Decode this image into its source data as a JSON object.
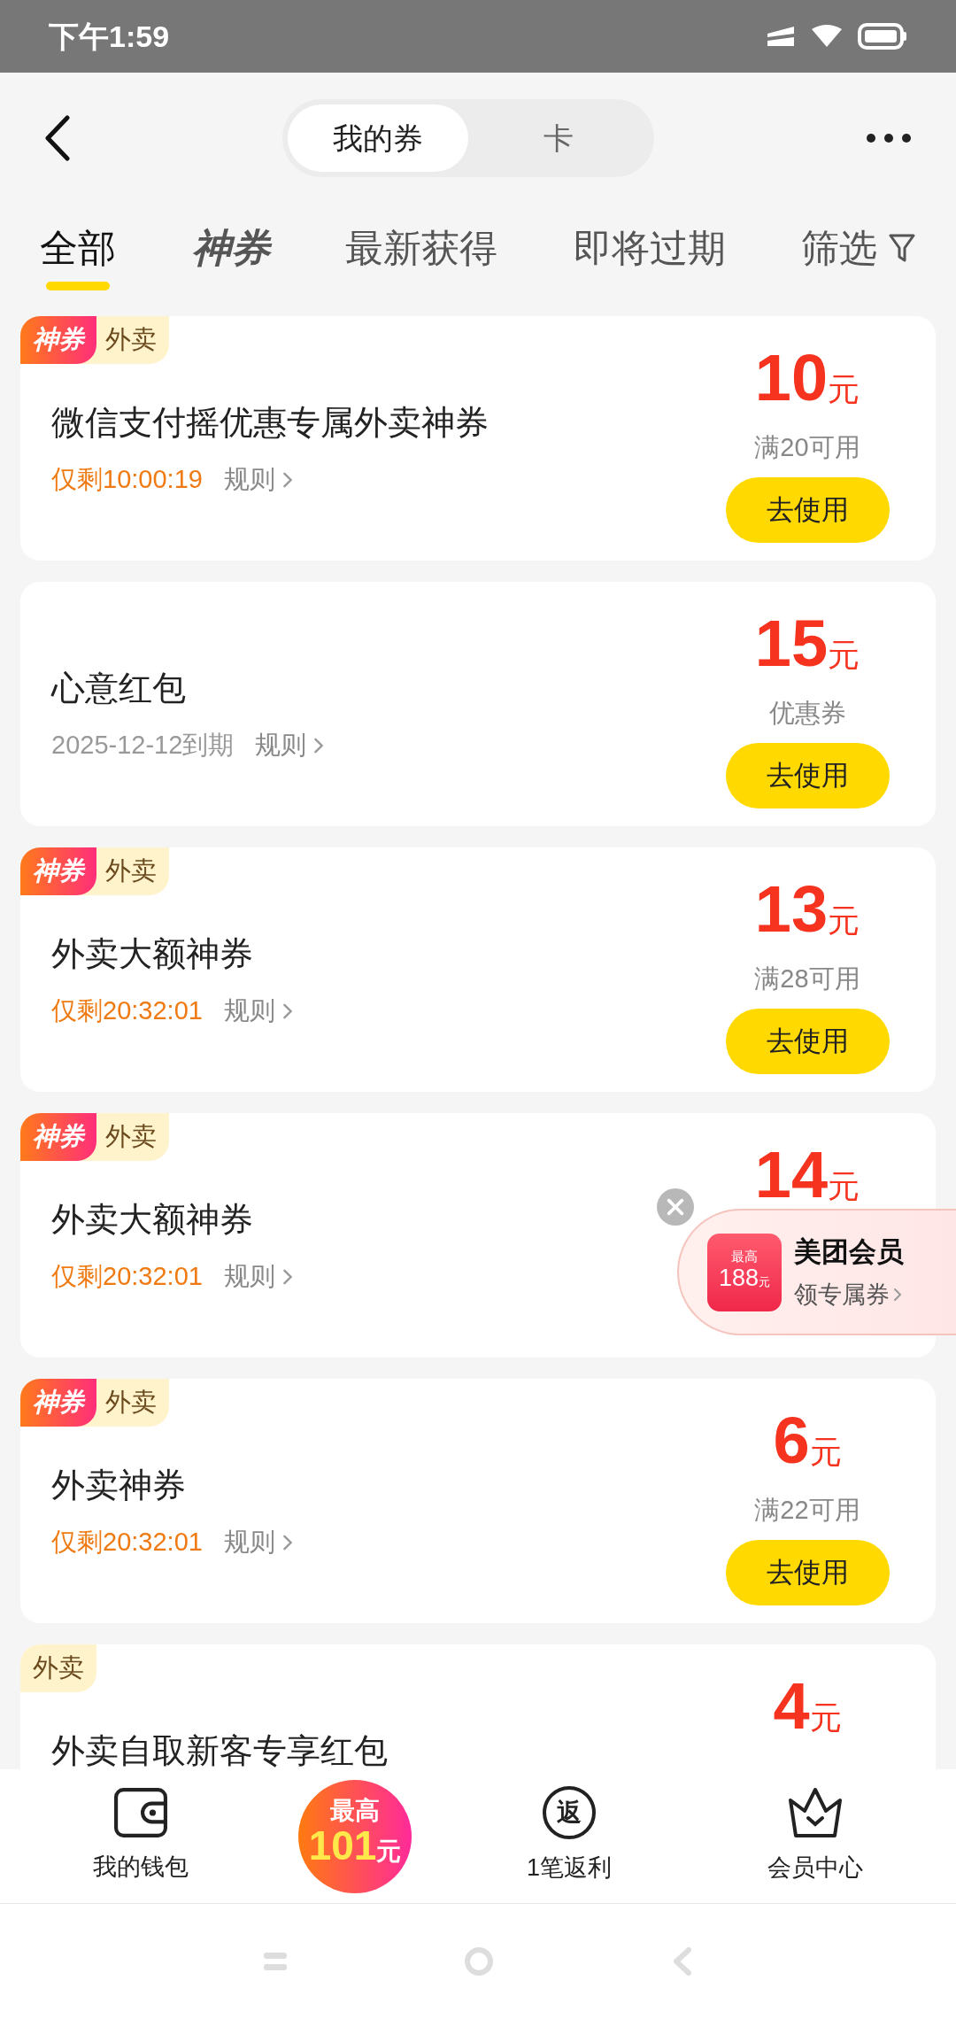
{
  "status_bar": {
    "time": "下午1:59"
  },
  "segments": [
    {
      "label": "我的券",
      "selected": true
    },
    {
      "label": "卡",
      "selected": false
    }
  ],
  "tabs": [
    {
      "label": "全部",
      "kind": "text",
      "selected": true
    },
    {
      "label": "神券",
      "kind": "brand",
      "selected": false
    },
    {
      "label": "最新获得",
      "kind": "text",
      "selected": false
    },
    {
      "label": "即将过期",
      "kind": "text",
      "selected": false
    },
    {
      "label": "筛选",
      "kind": "filter",
      "selected": false
    }
  ],
  "coupons": [
    {
      "special_tag": "神券",
      "category": "外卖",
      "title": "微信支付摇优惠专属外卖神券",
      "expiry": {
        "kind": "countdown",
        "text": "仅剩10:00:19"
      },
      "rules": "规则",
      "amount": "10",
      "unit": "元",
      "condition": "满20可用",
      "button": "去使用"
    },
    {
      "title": "心意红包",
      "expiry": {
        "kind": "date",
        "text": "2025-12-12到期"
      },
      "rules": "规则",
      "amount": "15",
      "unit": "元",
      "condition": "优惠券",
      "button": "去使用"
    },
    {
      "special_tag": "神券",
      "category": "外卖",
      "title": "外卖大额神券",
      "expiry": {
        "kind": "countdown",
        "text": "仅剩20:32:01"
      },
      "rules": "规则",
      "amount": "13",
      "unit": "元",
      "condition": "满28可用",
      "button": "去使用"
    },
    {
      "special_tag": "神券",
      "category": "外卖",
      "title": "外卖大额神券",
      "expiry": {
        "kind": "countdown",
        "text": "仅剩20:32:01"
      },
      "rules": "规则",
      "amount": "14",
      "unit": "元"
    },
    {
      "special_tag": "神券",
      "category": "外卖",
      "title": "外卖神券",
      "expiry": {
        "kind": "countdown",
        "text": "仅剩20:32:01"
      },
      "rules": "规则",
      "amount": "6",
      "unit": "元",
      "condition": "满22可用",
      "button": "去使用"
    },
    {
      "category": "外卖",
      "title": "外卖自取新客专享红包",
      "amount": "4",
      "unit": "元"
    }
  ],
  "member_promo": {
    "badge_top": "最高",
    "badge_amount": "188",
    "badge_unit": "元",
    "title": "美团会员",
    "link": "领专属券"
  },
  "bottom_nav": [
    {
      "kind": "wallet",
      "label": "我的钱包"
    },
    {
      "kind": "promo",
      "top": "最高",
      "amount": "101",
      "unit": "元"
    },
    {
      "kind": "rebate",
      "icon_text": "返",
      "label": "1笔返利"
    },
    {
      "kind": "crown",
      "label": "会员中心"
    }
  ]
}
